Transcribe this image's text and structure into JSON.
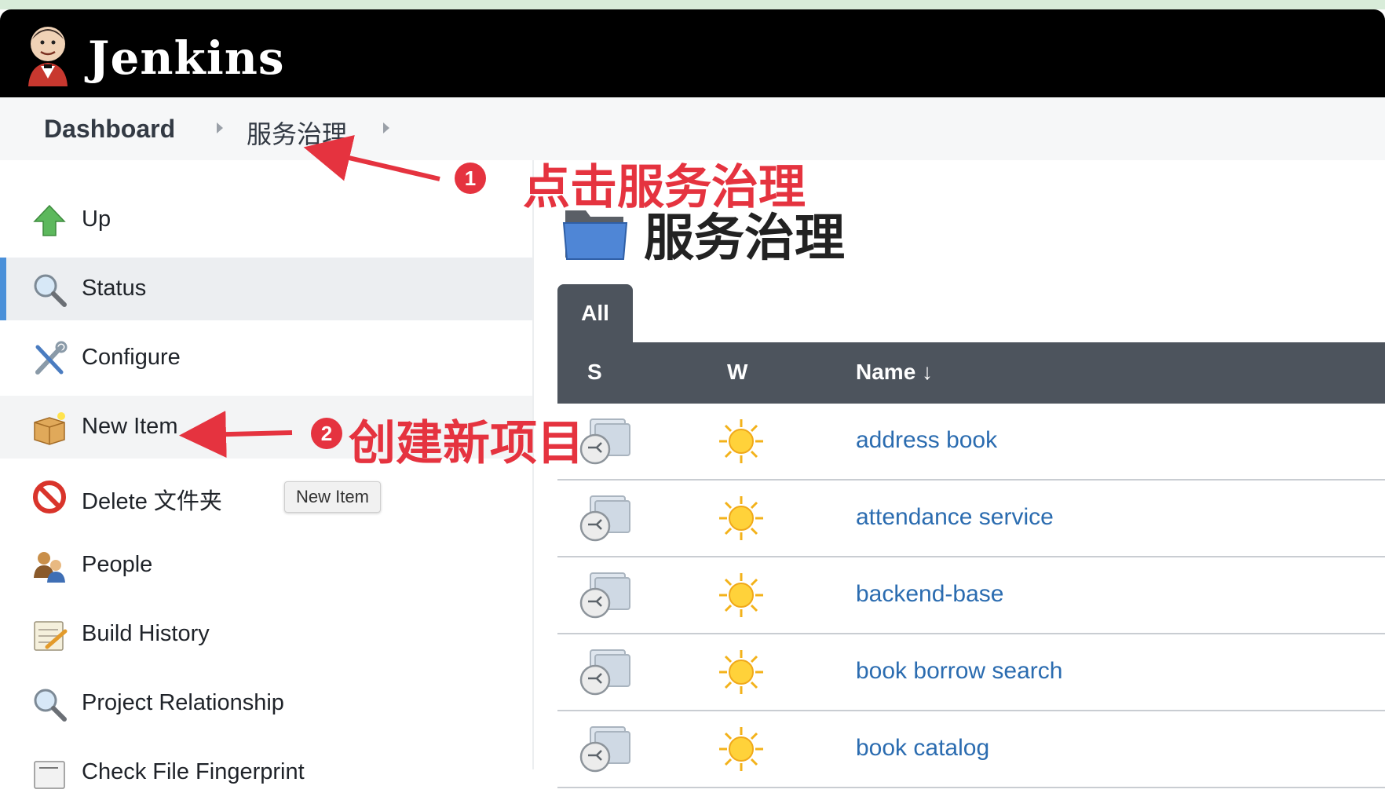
{
  "header": {
    "brand": "Jenkins",
    "logo_icon": "jenkins-butler-logo"
  },
  "breadcrumb": {
    "items": [
      "Dashboard",
      "服务治理"
    ]
  },
  "sidebar": {
    "items": [
      {
        "label": "Up",
        "icon": "up-arrow-icon"
      },
      {
        "label": "Status",
        "icon": "magnifier-icon"
      },
      {
        "label": "Configure",
        "icon": "wrench-screwdriver-icon"
      },
      {
        "label": "New Item",
        "icon": "new-package-icon"
      },
      {
        "label": "Delete 文件夹",
        "icon": "no-entry-icon"
      },
      {
        "label": "People",
        "icon": "people-icon"
      },
      {
        "label": "Build History",
        "icon": "notepad-icon"
      },
      {
        "label": "Project Relationship",
        "icon": "magnifier-icon"
      },
      {
        "label": "Check File Fingerprint",
        "icon": "fingerprint-icon"
      }
    ],
    "active_index": 1,
    "tooltip": "New Item"
  },
  "main": {
    "title": "服务治理",
    "view_tab": "All",
    "columns": {
      "status": "S",
      "weather": "W",
      "name": "Name ↓"
    },
    "jobs": [
      {
        "name": "address book"
      },
      {
        "name": "attendance service"
      },
      {
        "name": "backend-base"
      },
      {
        "name": "book borrow search"
      },
      {
        "name": "book catalog"
      }
    ]
  },
  "annotations": {
    "step1_number": "1",
    "step1_text": "点击服务治理",
    "step2_number": "2",
    "step2_text": "创建新项目",
    "color": "#e5333f"
  }
}
